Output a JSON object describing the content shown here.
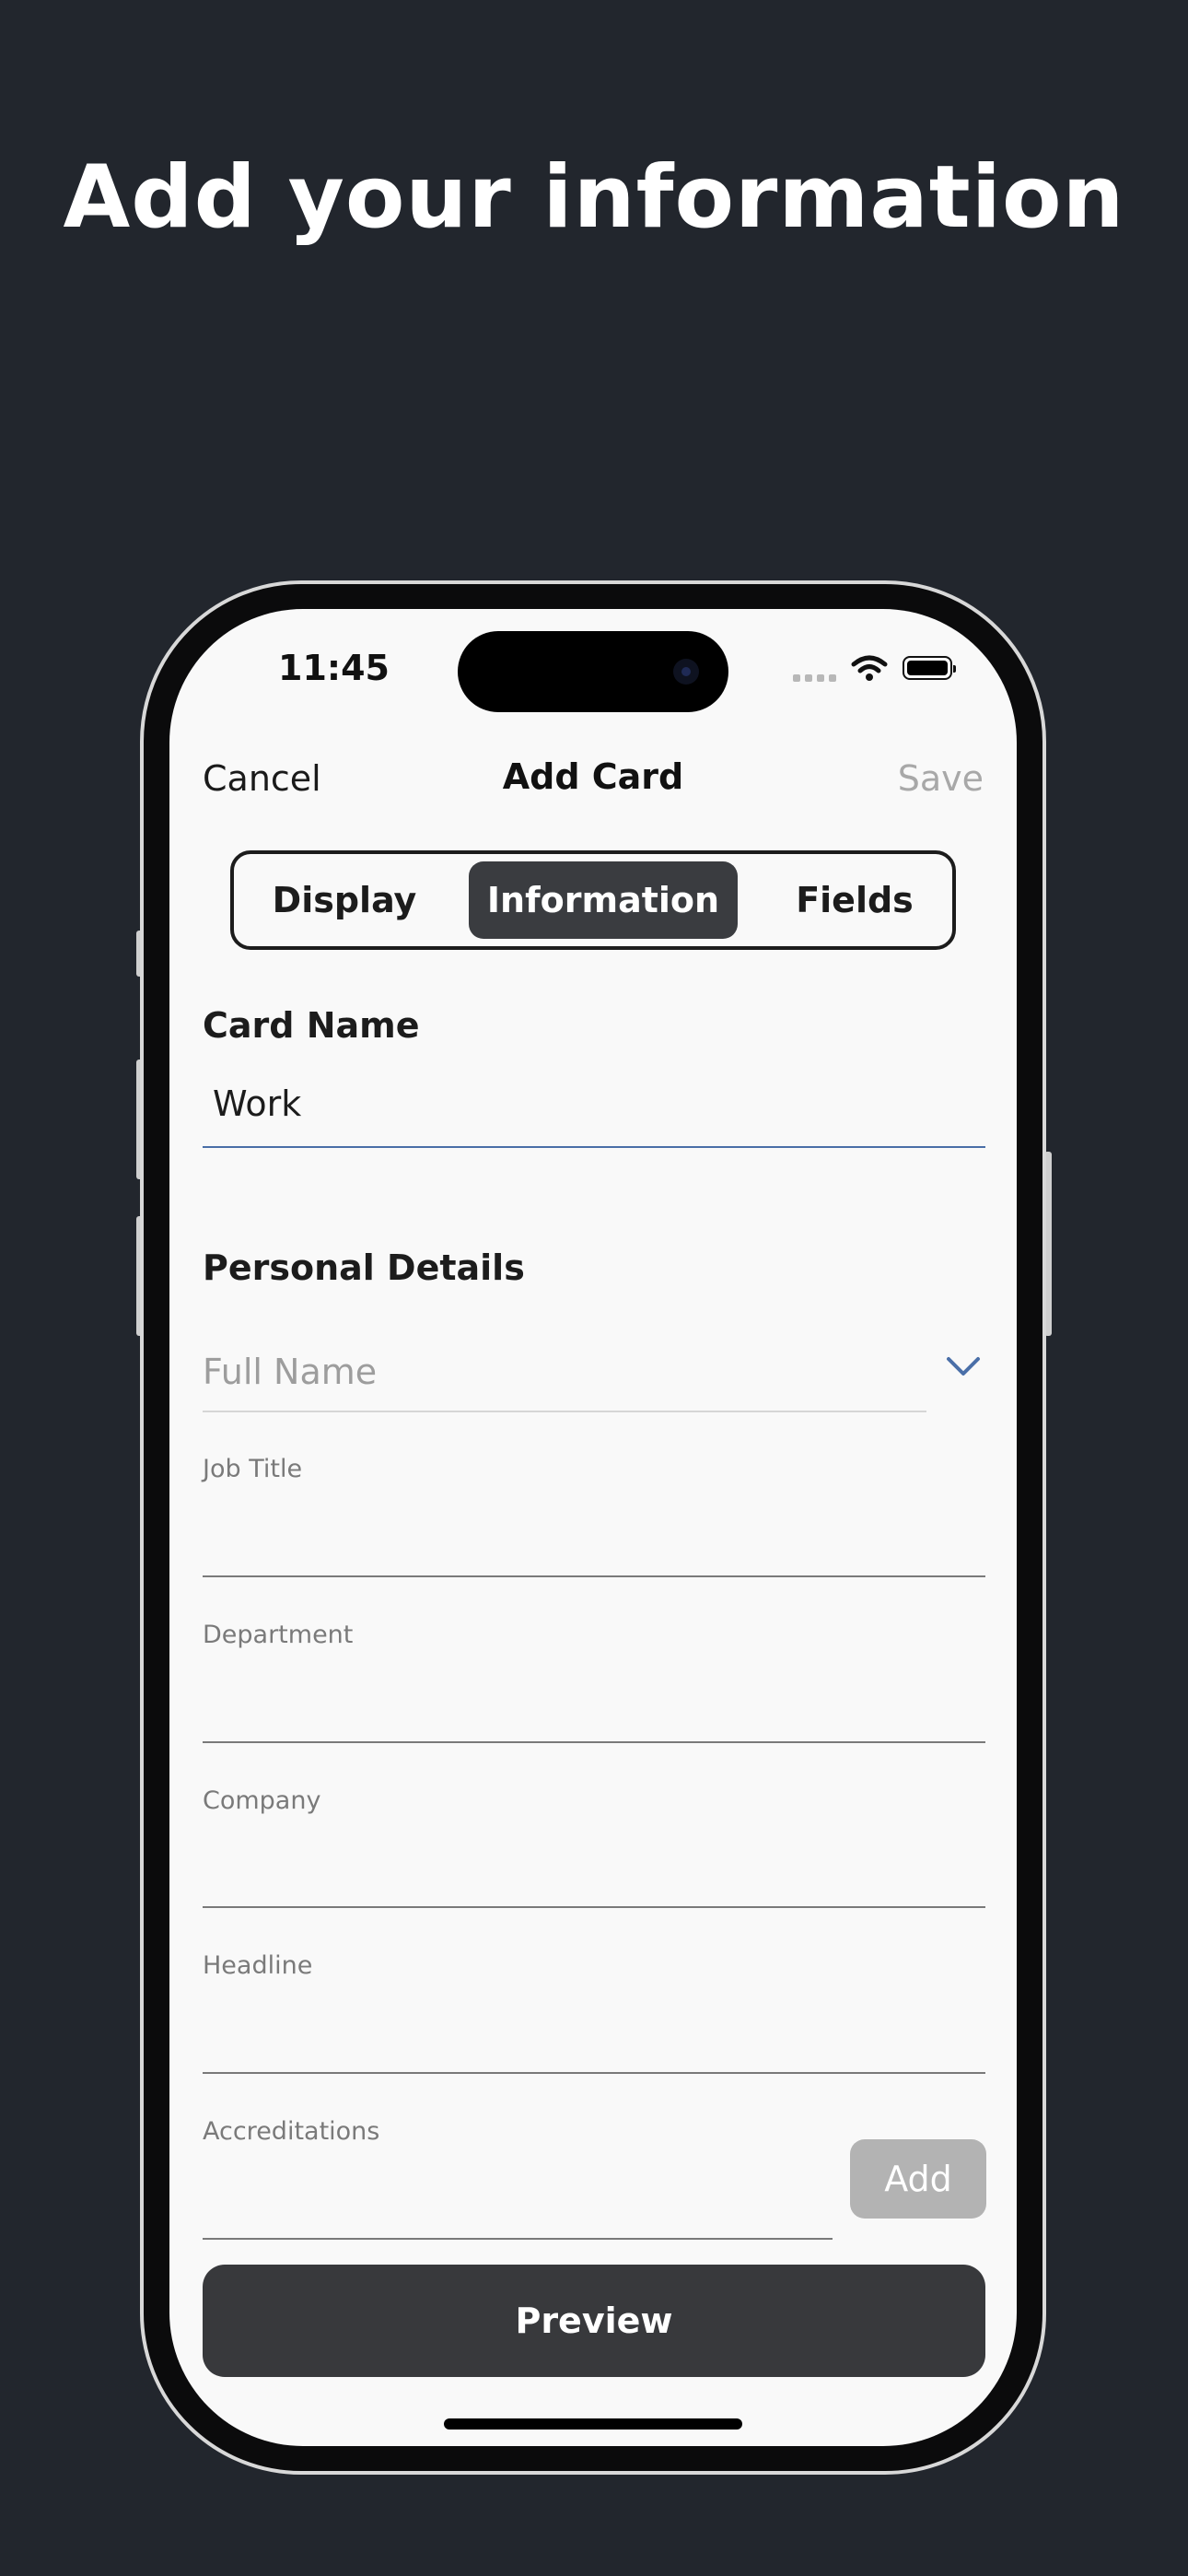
{
  "headline": "Add your information",
  "status_bar": {
    "time": "11:45"
  },
  "nav": {
    "cancel": "Cancel",
    "title": "Add Card",
    "save": "Save"
  },
  "segments": [
    {
      "label": "Display",
      "active": false
    },
    {
      "label": "Information",
      "active": true
    },
    {
      "label": "Fields",
      "active": false
    }
  ],
  "card_name": {
    "label": "Card Name",
    "value": "Work"
  },
  "personal_details": {
    "heading": "Personal Details",
    "full_name_placeholder": "Full Name",
    "fields": [
      "Job Title",
      "Department",
      "Company",
      "Headline",
      "Accreditations"
    ]
  },
  "buttons": {
    "add": "Add",
    "preview": "Preview"
  },
  "colors": {
    "background": "#22262d",
    "screen": "#f9f9f9",
    "active_segment": "#3a3c40",
    "preview_button": "#38393c",
    "add_button": "#b3b3b3",
    "focus_underline": "#4a6fa8"
  },
  "icons": [
    "wifi-icon",
    "battery-icon",
    "chevron-down-icon",
    "cellular-signal-icon"
  ]
}
